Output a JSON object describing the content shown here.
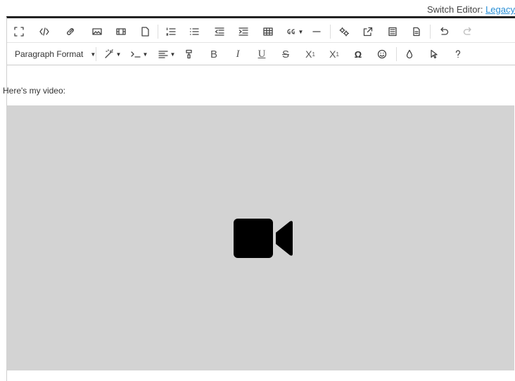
{
  "switch_editor": {
    "label": "Switch Editor: ",
    "link": "Legacy"
  },
  "toolbar_row1": [
    {
      "name": "fullscreen-icon"
    },
    {
      "name": "code-view-icon"
    },
    {
      "name": "insert-link-icon"
    },
    {
      "name": "insert-image-icon"
    },
    {
      "name": "insert-video-icon"
    },
    {
      "name": "insert-file-icon"
    },
    {
      "name": "ordered-list-icon"
    },
    {
      "name": "unordered-list-icon"
    },
    {
      "name": "outdent-icon"
    },
    {
      "name": "indent-icon"
    },
    {
      "name": "insert-table-icon"
    },
    {
      "name": "quote-icon"
    },
    {
      "name": "horizontal-line-icon"
    },
    {
      "name": "settings-icon"
    },
    {
      "name": "open-external-icon"
    },
    {
      "name": "template-icon"
    },
    {
      "name": "document-icon"
    },
    {
      "name": "undo-icon"
    },
    {
      "name": "redo-icon"
    }
  ],
  "toolbar_row2": {
    "paragraph_format": "Paragraph Format",
    "bold": "B",
    "italic": "I",
    "underline": "U",
    "strikethrough": "S",
    "subscript_base": "X",
    "subscript_mark": "1",
    "superscript_base": "X",
    "superscript_mark": "1",
    "special_char": "Ω"
  },
  "content": {
    "paragraph": "Here's my video:"
  },
  "colors": {
    "link": "#2a8fd6",
    "video_placeholder": "#d3d3d3",
    "toolbar_top_border": "#222222"
  }
}
